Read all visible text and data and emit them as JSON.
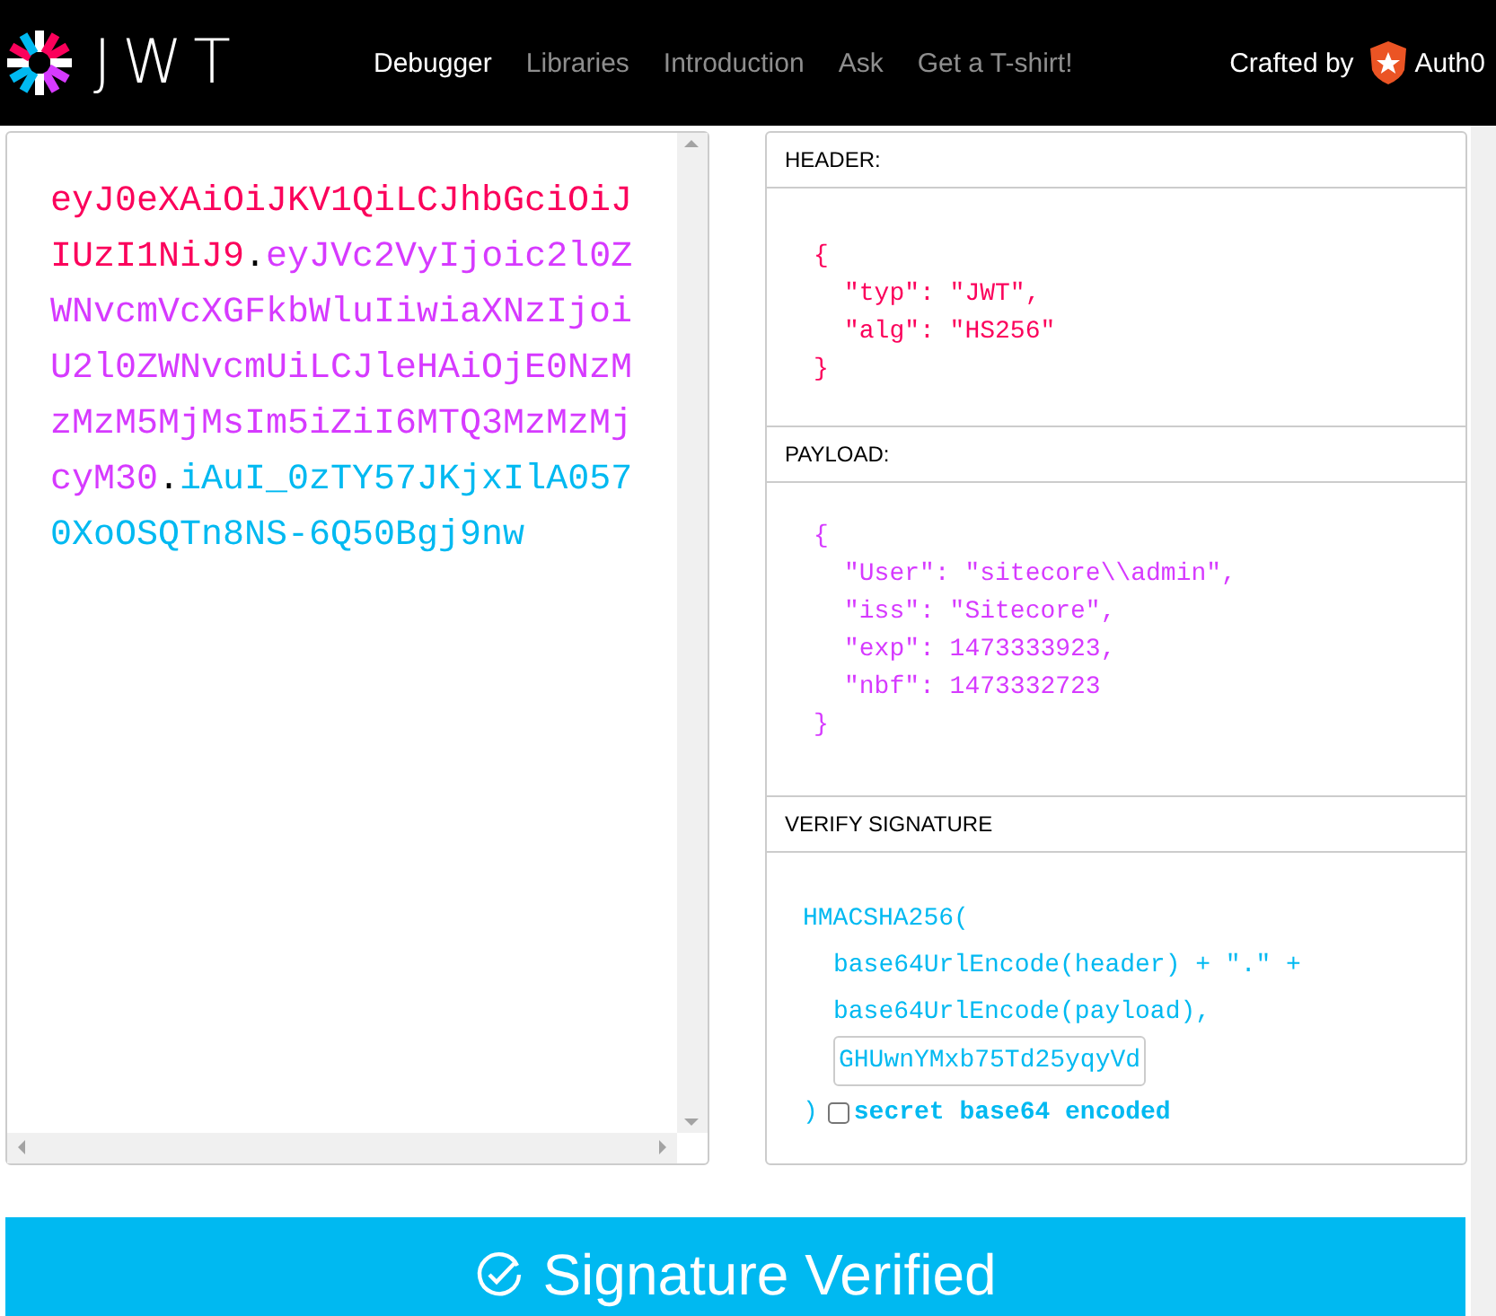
{
  "navbar": {
    "logo_text": "JWT",
    "items": [
      {
        "label": "Debugger",
        "selected": true
      },
      {
        "label": "Libraries",
        "selected": false
      },
      {
        "label": "Introduction",
        "selected": false
      },
      {
        "label": "Ask",
        "selected": false
      },
      {
        "label": "Get a T-shirt!",
        "selected": false
      }
    ],
    "crafted_by": "Crafted by",
    "brand": "Auth0"
  },
  "encoded": {
    "token": [
      {
        "kind": "header",
        "text": "eyJ0eXAiOiJKV1QiLCJhbGciOiJIUzI1NiJ9"
      },
      {
        "kind": "dot",
        "text": "."
      },
      {
        "kind": "payload",
        "text": "eyJVc2VyIjoic2l0ZWNvcmVcXGFkbWluIiwiaXNzIjoiU2l0ZWNvcmUiLCJleHAiOjE0NzMzMzM5MjMsIm5iZiI6MTQ3MzMzMjcyM30"
      },
      {
        "kind": "dot",
        "text": "."
      },
      {
        "kind": "signature",
        "text": "iAuI_0zTY57JKjxIlA0570XoOSQTn8NS-6Q50Bgj9nw"
      }
    ]
  },
  "decoded": {
    "sections": [
      {
        "kind": "header",
        "title": "HEADER:",
        "lines": [
          {
            "kind": "brace",
            "text": "{"
          },
          {
            "kind": "entry",
            "text": "\"typ\": \"JWT\","
          },
          {
            "kind": "entry",
            "text": "\"alg\": \"HS256\""
          },
          {
            "kind": "brace",
            "text": "}"
          }
        ]
      },
      {
        "kind": "payload",
        "title": "PAYLOAD:",
        "lines": [
          {
            "kind": "brace",
            "text": "{"
          },
          {
            "kind": "entry",
            "text": "\"User\": \"sitecore\\\\admin\","
          },
          {
            "kind": "entry",
            "text": "\"iss\": \"Sitecore\","
          },
          {
            "kind": "entry",
            "text": "\"exp\": 1473333923,"
          },
          {
            "kind": "entry",
            "text": "\"nbf\": 1473332723"
          },
          {
            "kind": "brace",
            "text": "}"
          }
        ]
      },
      {
        "kind": "signature",
        "title": "VERIFY SIGNATURE",
        "lines": [
          {
            "kind": "brace",
            "text": "HMACSHA256("
          },
          {
            "kind": "entry",
            "text": "base64UrlEncode(header) + \".\" +"
          },
          {
            "kind": "entry",
            "text": "base64UrlEncode(payload),"
          }
        ],
        "secret": {
          "value": "GHUwnYMxb75Td25yqyVd"
        },
        "closing": ")",
        "base64_checkbox": {
          "label": "secret base64 encoded",
          "checked": false
        }
      }
    ]
  },
  "status": {
    "text": "Signature Verified",
    "verified": true
  }
}
